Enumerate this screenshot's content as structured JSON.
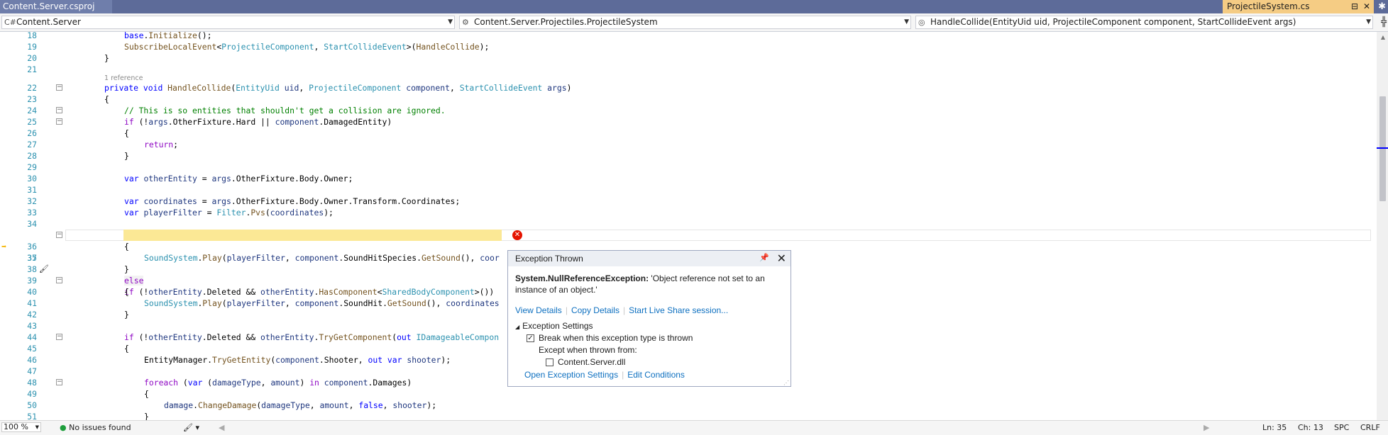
{
  "title_bar": {
    "project_tab": "Content.Server.csproj",
    "file_tab": "ProjectileSystem.cs"
  },
  "nav_bar": {
    "project_dropdown": "Content.Server",
    "type_dropdown": "Content.Server.Projectiles.ProjectileSystem",
    "member_dropdown": "HandleCollide(EntityUid uid, ProjectileComponent component, StartCollideEvent args)"
  },
  "editor": {
    "codelens": "1 reference",
    "lines": [
      {
        "n": "18"
      },
      {
        "n": "19"
      },
      {
        "n": "20"
      },
      {
        "n": "21"
      },
      {
        "n": "22"
      },
      {
        "n": "23"
      },
      {
        "n": "24"
      },
      {
        "n": "25"
      },
      {
        "n": "26"
      },
      {
        "n": "27"
      },
      {
        "n": "28"
      },
      {
        "n": "29"
      },
      {
        "n": "30"
      },
      {
        "n": "31"
      },
      {
        "n": "32"
      },
      {
        "n": "33"
      },
      {
        "n": "34"
      },
      {
        "n": "35"
      },
      {
        "n": "36"
      },
      {
        "n": "37"
      },
      {
        "n": "38"
      },
      {
        "n": "39"
      },
      {
        "n": "40"
      },
      {
        "n": "41"
      },
      {
        "n": "42"
      },
      {
        "n": "43"
      },
      {
        "n": "44"
      },
      {
        "n": "45"
      },
      {
        "n": "46"
      },
      {
        "n": "47"
      },
      {
        "n": "48"
      },
      {
        "n": "49"
      },
      {
        "n": "50"
      },
      {
        "n": "51"
      }
    ]
  },
  "exception_popup": {
    "title": "Exception Thrown",
    "exception_type": "System.NullReferenceException:",
    "message": " 'Object reference not set to an instance of an object.'",
    "links": {
      "view_details": "View Details",
      "copy_details": "Copy Details",
      "live_share": "Start Live Share session..."
    },
    "settings_header": "Exception Settings",
    "break_when_thrown": "Break when this exception type is thrown",
    "break_checked": true,
    "except_when_thrown_from": "Except when thrown from:",
    "module_name": "Content.Server.dll",
    "module_checked": false,
    "open_settings": "Open Exception Settings",
    "edit_conditions": "Edit Conditions"
  },
  "status_bar": {
    "zoom": "100 %",
    "issues": "No issues found",
    "line": "Ln: 35",
    "column": "Ch: 13",
    "whitespace": "SPC",
    "line_ending": "CRLF"
  },
  "colors": {
    "keyword": "#0000ff",
    "type": "#2b91af",
    "method": "#74531f",
    "comment": "#008000",
    "control": "#8f08c4",
    "current_statement": "#fbe895",
    "error": "#e51400",
    "link": "#0e70c0"
  }
}
